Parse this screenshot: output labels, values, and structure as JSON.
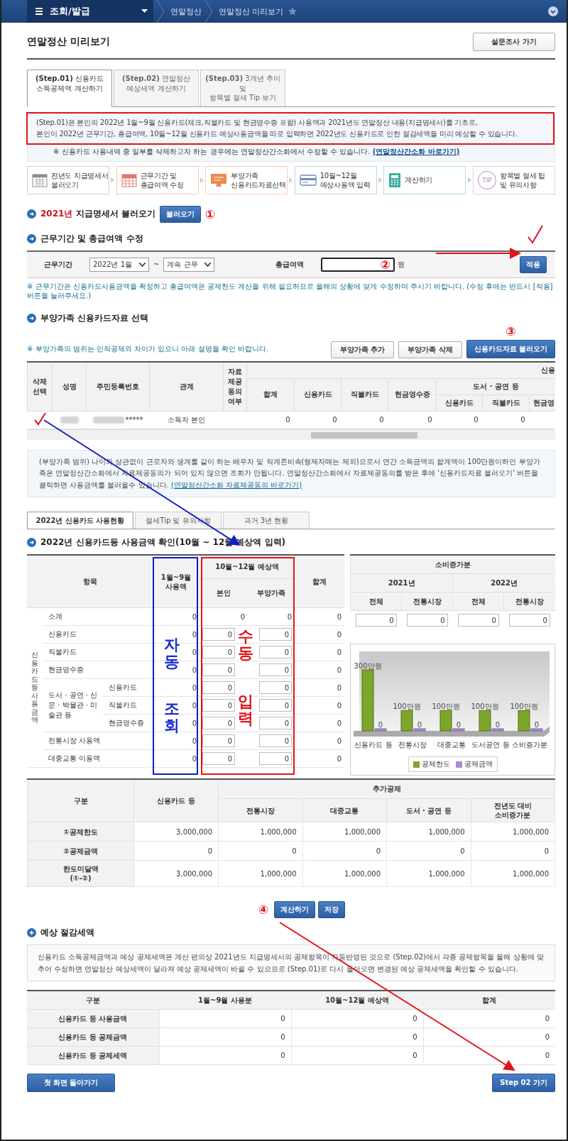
{
  "nav": {
    "menu_title": "조회/발급",
    "breadcrumbs": [
      "연말정산",
      "연말정산 미리보기"
    ]
  },
  "page": {
    "title": "연말정산 미리보기",
    "survey_button": "설문조사 가기"
  },
  "step_tabs": [
    {
      "lines": [
        "**(Step.01)** 신용카드",
        "소득공제액 계산하기"
      ],
      "selected": true
    },
    {
      "lines": [
        "**(Step.02)** 연말정산",
        "예상세액 계산하기"
      ],
      "selected": false
    },
    {
      "lines": [
        "**(Step.03)** 3개년 추이 및",
        "항목별 절세 Tip 보기"
      ],
      "selected": false
    }
  ],
  "intro": {
    "lines": [
      "(Step.01)은 본인의 2022년 1월~9월 신용카드(체크,직불카드 및 현금영수증 포함) 사용액과 2021년도 연말정산 내용(지급명세서)를 기초로,",
      "본인이 2022년 근무기간, 총급여액, 10월~12월 신용카드 예상사용금액을 따로 입력하면 2022년도 신용카드로 인한 절감세액을 미리 예상할 수 있습니다."
    ],
    "note": "※ 신용카드 사용내역 중 일부를 삭제하고자 하는 경우에는 연말정산간소화에서 수정할 수 있습니다.",
    "link": "(연말정산간소화 바로가기)"
  },
  "process_steps": [
    {
      "kind": "calendar",
      "lines": [
        "전년도 지급명세서",
        "불러오기"
      ],
      "color": "#8c8c8c"
    },
    {
      "kind": "grid",
      "lines": [
        "근무기간 및",
        "총급여액 수정"
      ],
      "color": "#e0766a"
    },
    {
      "kind": "monitor",
      "lines": [
        "부양가족",
        "신용카드자료선택"
      ],
      "color": "#ee8a4e"
    },
    {
      "kind": "card",
      "lines": [
        "10월~12월",
        "예상사용액 입력"
      ],
      "color": "#6d8cc4"
    },
    {
      "kind": "calculator",
      "lines": [
        "계산하기"
      ],
      "color": "#3fb0a0"
    },
    {
      "kind": "tip",
      "icon_text": "TIP",
      "lines": [
        "항목별 절세 팁",
        "및 유의사항"
      ],
      "color": "#b184c8"
    }
  ],
  "load_section": {
    "year": "2021년",
    "title": "지급명세서 불러오기",
    "button": "불러오기",
    "marker": "①"
  },
  "work_section": {
    "title": "근무기간 및 총급여액 수정",
    "period_label": "근무기간",
    "start": "2022년 1월",
    "tilde": "~",
    "end": "계속 근무",
    "salary_label": "총급여액",
    "marker": "②",
    "unit": "원",
    "button": "적용",
    "note": "※ 근무기간은 신용카드사용금액을 확정하고 총급여액은 공제한도 계산을 위해 필요하므로 올해의 상황에 맞게 수정하여 주시기 바랍니다. (수정 후에는 반드시 [적용] 버튼을 눌러주세요.)"
  },
  "family_section": {
    "title": "부양가족 신용카드자료 선택",
    "note": "※ 부양가족의 범위는 인적공제와 차이가 있으니 아래 설명을 확인 바랍니다.",
    "buttons": [
      "부양가족 추가",
      "부양가족 삭제"
    ],
    "load_button": "신용카드자료 불러오기",
    "marker": "③",
    "columns": [
      "삭제선택",
      "성명",
      "주민등록번호",
      "관계",
      "자료제공동의여부"
    ],
    "group_header": "신용",
    "amount_columns": [
      "합계",
      "신용카드",
      "직불카드",
      "현금영수증"
    ],
    "books_header": "도서 · 공연 등",
    "books_columns": [
      "신용카드",
      "직불카드",
      "현금영"
    ],
    "rows": [
      {
        "id_tail": "*****",
        "relation": "소득자 본인",
        "values": [
          "0",
          "0",
          "0",
          "0",
          "0",
          "0"
        ]
      }
    ],
    "info": "(부양가족 범위) 나이와 상관없이 근로자와 생계를 같이 하는 배우자 및 직계존비속(형제자매는 제외)으로서 연간 소득금액의 합계액이 100만원이하인 부양가족은 연말정산간소화에서 자료제공동의가 되어 있지 않으면 조회가 안됩니다. 연말정산간소화에서 자료제공동의를 받은 후에 '신용카드자료 불러오기' 버튼을 클릭하면 사용금액를 불러올수 있습니다.",
    "info_link": "(연말정산간소화 자료제공동의 바로가기)"
  },
  "usage_tabs": [
    {
      "label": "2022년 신용카드 사용현황",
      "selected": true
    },
    {
      "label": "절세Tip 및 유의사항",
      "selected": false
    },
    {
      "label": "과거 3년 현황",
      "selected": false
    }
  ],
  "usage_section": {
    "title": "2022년 신용카드등 사용금액 확인(10월 ~ 12월 예상액 입력)",
    "headers": {
      "item": "항목",
      "jan_sep": "1월~9월\n사용액",
      "oct_dec": "10월~12월 예상액",
      "self": "본인",
      "dependents": "부양가족",
      "total": "합계"
    },
    "group_label": "신용카드등 사용금액",
    "rows": [
      {
        "kind": "subtotal",
        "label": "소계",
        "values": [
          "0",
          "0",
          "0",
          "0"
        ]
      },
      {
        "kind": "input",
        "label": "신용카드",
        "values": [
          "0",
          "0",
          "0",
          "0"
        ]
      },
      {
        "kind": "input",
        "label": "직불카드",
        "values": [
          "0",
          "0",
          "0",
          "0"
        ]
      },
      {
        "kind": "input",
        "label": "현금영수증",
        "values": [
          "0",
          "0",
          "0",
          "0"
        ]
      },
      {
        "kind": "group",
        "label": "도서 · 공연 · 신문 · 박물관 · 미술관 등",
        "children": [
          {
            "label": "신용카드",
            "values": [
              "0",
              "0",
              "0",
              "0"
            ]
          },
          {
            "label": "직불카드",
            "values": [
              "0",
              "0",
              "0",
              "0"
            ]
          },
          {
            "label": "현금영수증",
            "values": [
              "0",
              "0",
              "0",
              "0"
            ]
          }
        ]
      },
      {
        "kind": "input",
        "label": "전통시장 사용액",
        "values": [
          "0",
          "0",
          "0",
          "0"
        ]
      },
      {
        "kind": "input",
        "label": "대중교통 이용액",
        "values": [
          "0",
          "0",
          "0",
          "0"
        ]
      }
    ],
    "auto_note": [
      "자동",
      "조회"
    ],
    "manual_note": [
      "수동",
      "입력"
    ],
    "increase": {
      "title": "소비증가분",
      "years": [
        "2021년",
        "2022년"
      ],
      "columns": [
        "전체",
        "전통시장",
        "전체",
        "전통시장"
      ],
      "values": [
        "0",
        "0",
        "0",
        "0"
      ]
    },
    "chart_data": {
      "type": "bar",
      "categories": [
        "신용카드 등",
        "전통시장",
        "대중교통",
        "도서공연 등",
        "소비증가분"
      ],
      "series": [
        {
          "name": "공제한도",
          "color": "#7da62a",
          "values": [
            300,
            100,
            100,
            100,
            100
          ],
          "value_labels": [
            "300만원",
            "100만원",
            "100만원",
            "100만원",
            "100만원"
          ]
        },
        {
          "name": "공제금액",
          "color": "#a98bd3",
          "values": [
            0,
            0,
            0,
            0,
            0
          ],
          "value_labels": [
            "0",
            "0",
            "0",
            "0",
            "0"
          ]
        }
      ]
    }
  },
  "deduction_table": {
    "headers": {
      "category": "구분",
      "cards": "신용카드 등",
      "extra": "추가공제",
      "extra_columns": [
        "전통시장",
        "대중교통",
        "도서 · 공연 등",
        "전년도 대비\n소비증가분"
      ]
    },
    "rows": [
      {
        "label": "①공제한도",
        "values": [
          "3,000,000",
          "1,000,000",
          "1,000,000",
          "1,000,000",
          "1,000,000"
        ]
      },
      {
        "label": "②공제금액",
        "values": [
          "0",
          "0",
          "0",
          "0",
          "0"
        ]
      },
      {
        "label": "한도미달액\n(①-②)",
        "values": [
          "3,000,000",
          "1,000,000",
          "1,000,000",
          "1,000,000",
          "1,000,000"
        ]
      }
    ]
  },
  "actions": {
    "marker": "④",
    "buttons": [
      "계산하기",
      "저장"
    ]
  },
  "savings_section": {
    "title": "예상 절감세액",
    "note": "신용카드 소득공제금액과 예상 공제세액은 계산 편의상 2021년도 지급명세서의 공제항목이 자동반영된 것으로 (Step.02)에서 각종 공제항목을 올해 상황에 맞추어 수정하면 연말정산 예상세액이 달라져 예상 공제세액이 바뀔 수 있으므로 (Step.01)로 다시 돌아오면 변경된 예상 공제세액을 확인할 수 있습니다.",
    "columns": [
      "구분",
      "1월~9월 사용분",
      "10월~12월 예상액",
      "합계"
    ],
    "rows": [
      {
        "label": "신용카드 등 사용금액",
        "values": [
          "0",
          "0",
          "0"
        ]
      },
      {
        "label": "신용카드 등 공제금액",
        "values": [
          "0",
          "0",
          "0"
        ]
      },
      {
        "label": "신용카드 등 공제세액",
        "values": [
          "0",
          "0",
          "0"
        ]
      }
    ]
  },
  "footer": {
    "back_button": "첫 화면 돌아가기",
    "next_button": "Step 02 가기"
  }
}
